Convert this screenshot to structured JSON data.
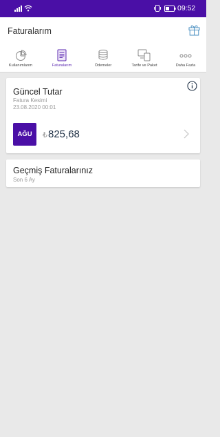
{
  "status_bar": {
    "time": "09:52"
  },
  "header": {
    "title": "Faturalarım",
    "gift_icon": "gift-icon"
  },
  "tabs": [
    {
      "label": "Kullanımlarım",
      "icon": "pie-chart-icon",
      "active": false
    },
    {
      "label": "Faturalarım",
      "icon": "invoice-icon",
      "active": true
    },
    {
      "label": "Ödemeler",
      "icon": "coins-icon",
      "active": false
    },
    {
      "label": "Tarife ve Paket",
      "icon": "devices-icon",
      "active": false
    },
    {
      "label": "Daha Fazla",
      "icon": "more-dots-icon",
      "active": false
    }
  ],
  "current_bill": {
    "title": "Güncel Tutar",
    "subtitle": "Fatura Kesimi",
    "date": "23.08.2020 00:01",
    "badge": "AĞU",
    "currency_symbol": "₺",
    "amount": "825,68"
  },
  "past_bills": {
    "title": "Geçmiş Faturalarınız",
    "subtitle": "Son 6 Ay"
  },
  "colors": {
    "brand": "#4a0fa6",
    "accent": "#5b28b0",
    "background": "#e9e9e9"
  }
}
